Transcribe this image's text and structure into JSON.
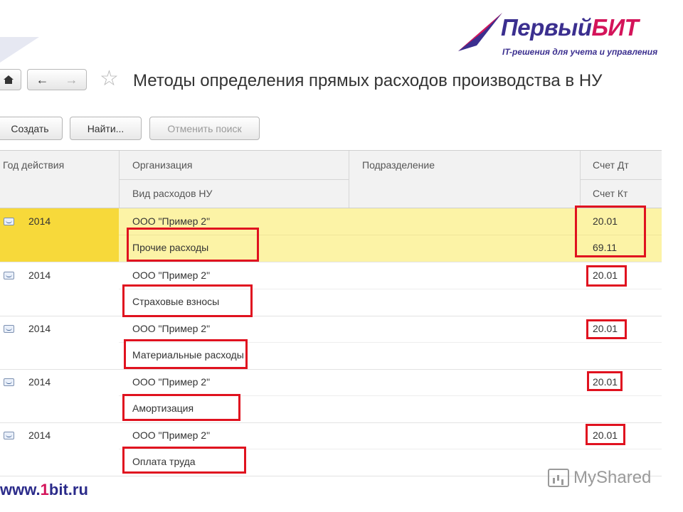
{
  "logo": {
    "title_part1": "Первый",
    "title_part2": "БИТ",
    "subtitle": "IT-решения для учета и управления"
  },
  "header": {
    "title": "Методы определения прямых расходов производства в НУ"
  },
  "toolbar": {
    "create_label": "Создать",
    "find_label": "Найти...",
    "cancel_search_label": "Отменить поиск"
  },
  "table": {
    "columns": {
      "year": "Год действия",
      "organization": "Организация",
      "expense_type": "Вид расходов НУ",
      "department": "Подразделение",
      "account_dt": "Счет Дт",
      "account_kt": "Счет Кт"
    },
    "rows": [
      {
        "year": "2014",
        "organization": "ООО \"Пример 2\"",
        "expense_type": "Прочие расходы",
        "department": "",
        "account_dt": "20.01",
        "account_kt": "69.11",
        "selected": true
      },
      {
        "year": "2014",
        "organization": "ООО \"Пример 2\"",
        "expense_type": "Страховые взносы",
        "department": "",
        "account_dt": "20.01",
        "account_kt": "",
        "selected": false
      },
      {
        "year": "2014",
        "organization": "ООО \"Пример 2\"",
        "expense_type": "Материальные расходы",
        "department": "",
        "account_dt": "20.01",
        "account_kt": "",
        "selected": false
      },
      {
        "year": "2014",
        "organization": "ООО \"Пример 2\"",
        "expense_type": "Амортизация",
        "department": "",
        "account_dt": "20.01",
        "account_kt": "",
        "selected": false
      },
      {
        "year": "2014",
        "organization": "ООО \"Пример 2\"",
        "expense_type": "Оплата труда",
        "department": "",
        "account_dt": "20.01",
        "account_kt": "",
        "selected": false
      }
    ]
  },
  "footer": {
    "url_prefix": "www.",
    "url_num": "1",
    "url_suffix": "bit.ru",
    "watermark": "MyShared"
  },
  "colors": {
    "selected_row": "#fcf3a6",
    "selected_year_cell": "#f7d93a",
    "highlight_border": "#e0121f",
    "brand_blue": "#3b2f8f",
    "brand_pink": "#d4145a"
  }
}
